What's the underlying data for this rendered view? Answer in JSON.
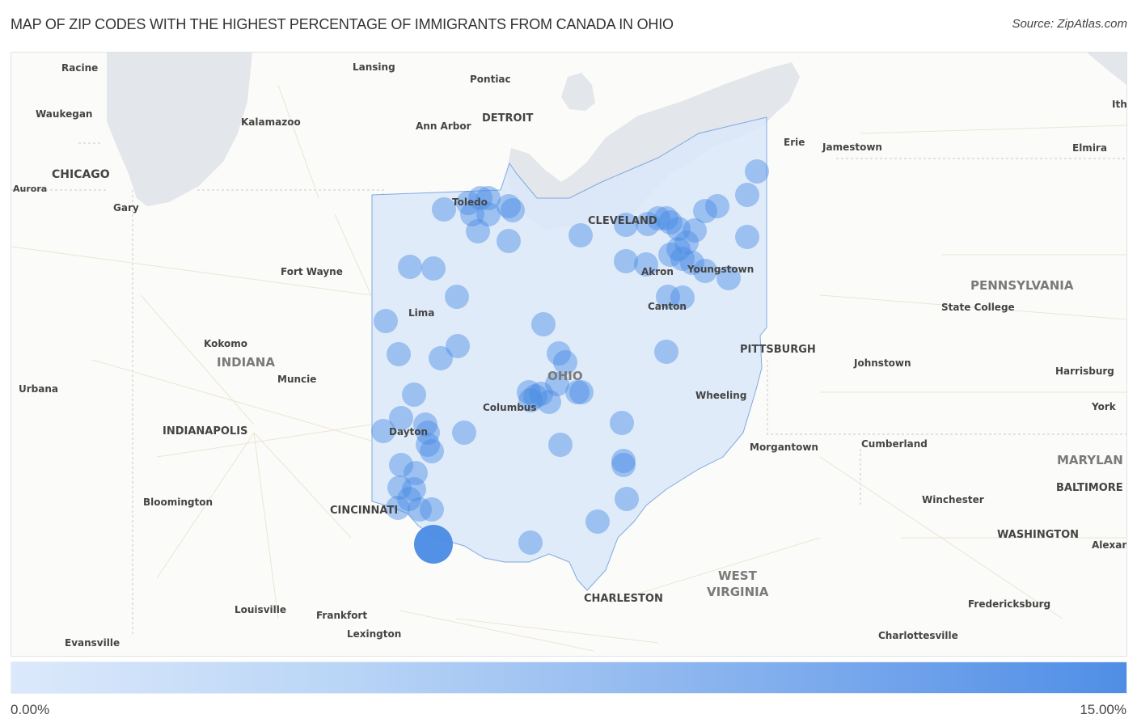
{
  "header": {
    "title": "MAP OF ZIP CODES WITH THE HIGHEST PERCENTAGE OF IMMIGRANTS FROM CANADA IN OHIO",
    "source": "Source: ZipAtlas.com"
  },
  "legend": {
    "min_label": "0.00%",
    "max_label": "15.00%",
    "min_color": "#dce9fb",
    "max_color": "#4f8ee6"
  },
  "colors": {
    "state_fill": "#dbe8f9",
    "state_border": "#7fa9e0",
    "water": "#e2e6ea",
    "bubble": "#4a8be5"
  },
  "map": {
    "state_labels": [
      "INDIANA",
      "OHIO",
      "PENNSYLVANIA",
      "WEST",
      "VIRGINIA",
      "MARYLAN"
    ],
    "city_labels": [
      "Racine",
      "Lansing",
      "Pontiac",
      "Waukegan",
      "Kalamazoo",
      "DETROIT",
      "Ann Arbor",
      "CHICAGO",
      "Aurora",
      "Gary",
      "Toledo",
      "CLEVELAND",
      "Erie",
      "Jamestown",
      "Elmira",
      "Ithac",
      "Fort Wayne",
      "Akron",
      "Youngstown",
      "Canton",
      "Lima",
      "PENNSYLVANIA",
      "State College",
      "Kokomo",
      "PITTSBURGH",
      "Johnstown",
      "Harrisburg",
      "Muncie",
      "Urbana",
      "Columbus",
      "Wheeling",
      "York",
      "INDIANAPOLIS",
      "Dayton",
      "Morgantown",
      "Cumberland",
      "Bloomington",
      "CINCINNATI",
      "Winchester",
      "BALTIMORE",
      "WASHINGTON",
      "Alexan",
      "CHARLESTON",
      "Louisville",
      "Frankfort",
      "Fredericksburg",
      "Lexington",
      "Charlottesville",
      "Evansville"
    ]
  }
}
